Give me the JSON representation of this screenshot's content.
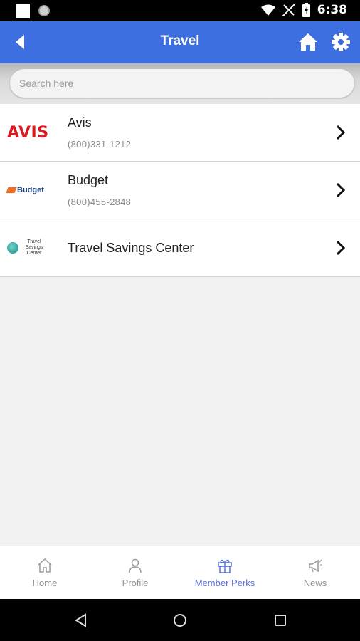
{
  "status": {
    "time": "6:38"
  },
  "appbar": {
    "title": "Travel"
  },
  "search": {
    "placeholder": "Search here"
  },
  "items": [
    {
      "name": "Avis",
      "phone": "(800)331-1212",
      "logo_text": "AVIS"
    },
    {
      "name": "Budget",
      "phone": "(800)455-2848",
      "logo_text": "Budget"
    },
    {
      "name": "Travel Savings Center",
      "logo_text": "Travel Savings Center"
    }
  ],
  "bottom_nav": [
    {
      "label": "Home",
      "icon": "home-icon"
    },
    {
      "label": "Profile",
      "icon": "profile-icon"
    },
    {
      "label": "Member Perks",
      "icon": "gift-icon",
      "active": true
    },
    {
      "label": "News",
      "icon": "megaphone-icon"
    }
  ],
  "colors": {
    "appbar": "#3d6fe0",
    "active_nav": "#5870d8",
    "avis_red": "#d71920"
  }
}
